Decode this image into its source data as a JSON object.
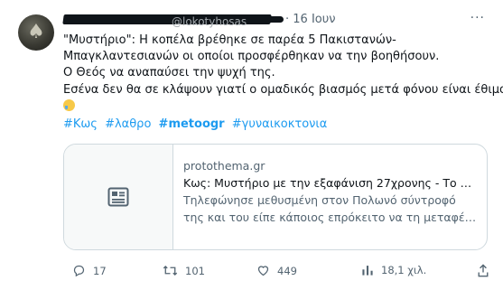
{
  "tweet": {
    "handle_partial": "@lokotyhosas",
    "timestamp": "16 Ιουν",
    "more_label": "···",
    "text_lines": [
      "\"Μυστήριο\": Η κοπέλα βρέθηκε σε παρέα 5 Πακιστανών-",
      "Μπαγκλαντεσιανών οι οποίοι προσφέρθηκαν να την βοηθήσουν.",
      "Ο Θεός να αναπαύσει την ψυχή της.",
      "Εσένα δεν θα σε κλάψουν γιατί ο ομαδικός βιασμός μετά φόνου είναι έθιμο."
    ],
    "emoji": "crying-face",
    "hashtags": [
      "#Κως",
      "#λαθρο",
      "#metoogr",
      "#γυναικοκτονια"
    ]
  },
  "card": {
    "domain": "protothema.gr",
    "title": "Κως: Μυστήριο με την εξαφάνιση 27χρονης - Το τε...",
    "desc_line1": "Τηλεφώνησε μεθυσμένη στον Πολωνό σύντροφό",
    "desc_line2": "της και του είπε κάποιος επρόκειτο να τη μεταφέρε..."
  },
  "actions": {
    "replies": "17",
    "retweets": "101",
    "likes": "449",
    "views": "18,1 χιλ."
  },
  "colors": {
    "accent": "#1d9bf0",
    "muted": "#536471",
    "border": "#cfd9de"
  }
}
